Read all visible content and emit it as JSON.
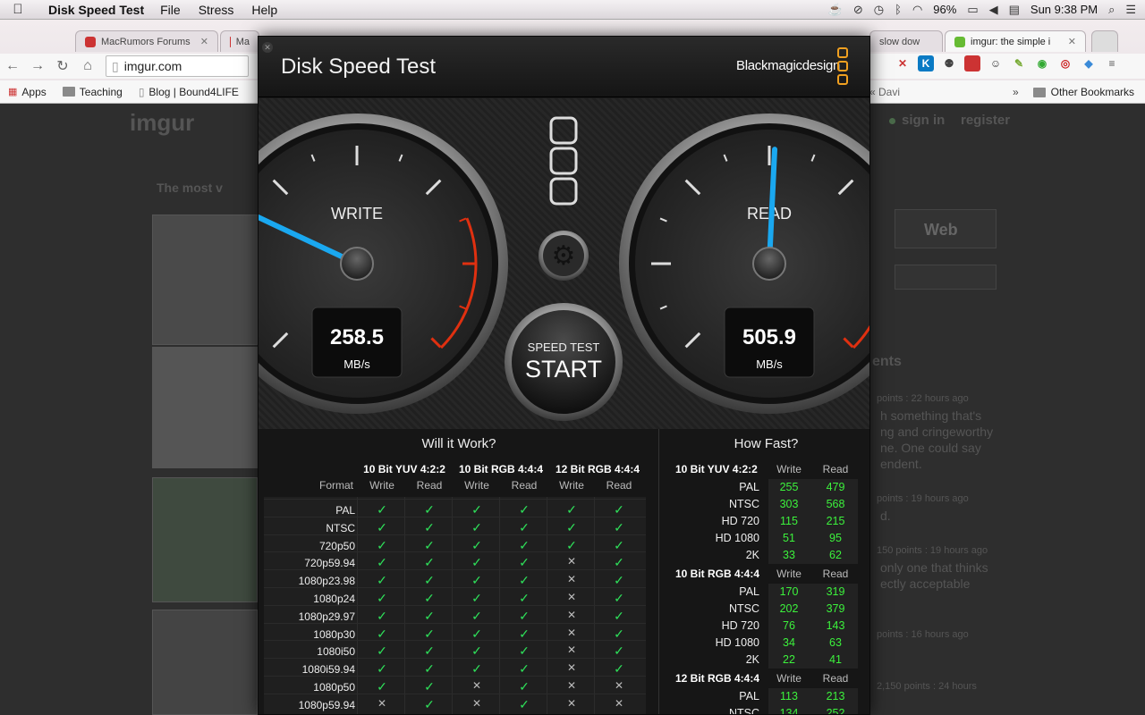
{
  "menubar": {
    "app": "Disk Speed Test",
    "items": [
      "File",
      "Stress",
      "Help"
    ],
    "battery": "96%",
    "clock": "Sun 9:38 PM"
  },
  "browser": {
    "tabs": [
      {
        "label": "MacRumors Forums"
      },
      {
        "label": "Ma"
      },
      {
        "label": "slow dow"
      },
      {
        "label": "imgur: the simple i"
      }
    ],
    "url": "imgur.com",
    "bookmarks": [
      "Apps",
      "Teaching",
      "Blog | Bound4LIFE"
    ],
    "other_bookmarks": "Other Bookmarks",
    "bm_partial": "« Davi",
    "more": "»"
  },
  "page": {
    "logo": "imgur",
    "signin": "sign in",
    "register": "register",
    "most": "The most v",
    "web": "Web",
    "comments_head": "ents",
    "comments": [
      {
        "meta": "points : 22 hours ago",
        "text": "h something that's\nng and cringeworthy\nne. One could say\nendent."
      },
      {
        "meta": "points : 19 hours ago",
        "text": "d."
      },
      {
        "meta": "150 points : 19 hours ago",
        "text": "only one that thinks\nectly acceptable"
      },
      {
        "meta": "points : 16 hours ago",
        "text": ""
      },
      {
        "meta": "2,150 points : 24 hours",
        "text": ""
      }
    ]
  },
  "app": {
    "title": "Disk Speed Test",
    "brand": "Blackmagicdesign",
    "write": {
      "label": "WRITE",
      "value": "258.5",
      "unit": "MB/s",
      "needle_fraction": 0.26
    },
    "read": {
      "label": "READ",
      "value": "505.9",
      "unit": "MB/s",
      "needle_fraction": 0.51
    },
    "start": {
      "small": "SPEED TEST",
      "big": "START"
    },
    "will": {
      "title": "Will it Work?",
      "groups": [
        "10 Bit YUV 4:2:2",
        "10 Bit RGB 4:4:4",
        "12 Bit RGB 4:4:4"
      ],
      "format_label": "Format",
      "write_label": "Write",
      "read_label": "Read",
      "rows": [
        {
          "f": "PAL",
          "v": [
            1,
            1,
            1,
            1,
            1,
            1
          ]
        },
        {
          "f": "NTSC",
          "v": [
            1,
            1,
            1,
            1,
            1,
            1
          ]
        },
        {
          "f": "720p50",
          "v": [
            1,
            1,
            1,
            1,
            1,
            1
          ]
        },
        {
          "f": "720p59.94",
          "v": [
            1,
            1,
            1,
            1,
            0,
            1
          ]
        },
        {
          "f": "1080p23.98",
          "v": [
            1,
            1,
            1,
            1,
            0,
            1
          ]
        },
        {
          "f": "1080p24",
          "v": [
            1,
            1,
            1,
            1,
            0,
            1
          ]
        },
        {
          "f": "1080p29.97",
          "v": [
            1,
            1,
            1,
            1,
            0,
            1
          ]
        },
        {
          "f": "1080p30",
          "v": [
            1,
            1,
            1,
            1,
            0,
            1
          ]
        },
        {
          "f": "1080i50",
          "v": [
            1,
            1,
            1,
            1,
            0,
            1
          ]
        },
        {
          "f": "1080i59.94",
          "v": [
            1,
            1,
            1,
            1,
            0,
            1
          ]
        },
        {
          "f": "1080p50",
          "v": [
            1,
            1,
            0,
            1,
            0,
            0
          ]
        },
        {
          "f": "1080p59.94",
          "v": [
            0,
            1,
            0,
            1,
            0,
            0
          ]
        }
      ]
    },
    "fast": {
      "title": "How Fast?",
      "write_label": "Write",
      "read_label": "Read",
      "groups": [
        {
          "name": "10 Bit YUV 4:2:2",
          "rows": [
            [
              "PAL",
              "255",
              "479"
            ],
            [
              "NTSC",
              "303",
              "568"
            ],
            [
              "HD 720",
              "115",
              "215"
            ],
            [
              "HD 1080",
              "51",
              "95"
            ],
            [
              "2K",
              "33",
              "62"
            ]
          ]
        },
        {
          "name": "10 Bit RGB 4:4:4",
          "rows": [
            [
              "PAL",
              "170",
              "319"
            ],
            [
              "NTSC",
              "202",
              "379"
            ],
            [
              "HD 720",
              "76",
              "143"
            ],
            [
              "HD 1080",
              "34",
              "63"
            ],
            [
              "2K",
              "22",
              "41"
            ]
          ]
        },
        {
          "name": "12 Bit RGB 4:4:4",
          "rows": [
            [
              "PAL",
              "113",
              "213"
            ],
            [
              "NTSC",
              "134",
              "252"
            ]
          ]
        }
      ]
    }
  },
  "colors": {
    "accent": "#f0a020",
    "needle": "#1aa8f0",
    "green": "#3cf23c"
  }
}
